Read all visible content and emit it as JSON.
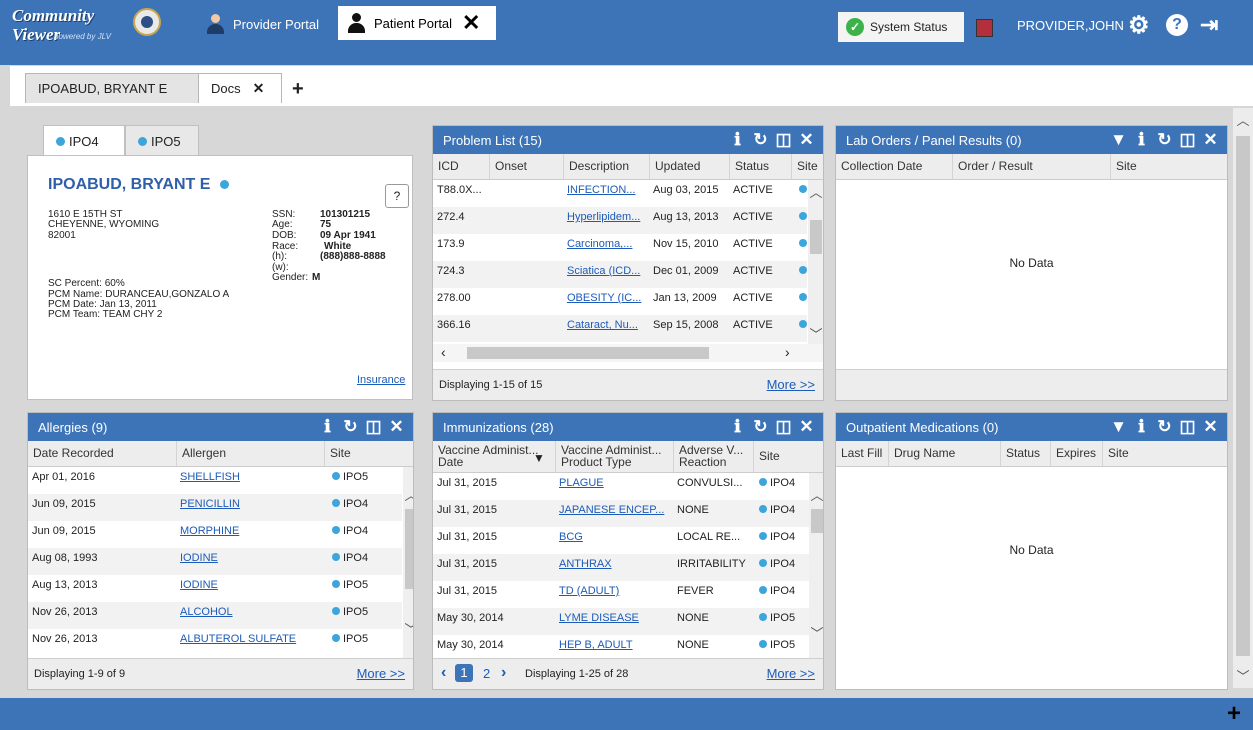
{
  "app": {
    "logo_line1": "Community",
    "logo_line2": "Viewer",
    "logo_tag": "powered by JLV"
  },
  "top_tabs": [
    {
      "label": "Provider Portal",
      "active": false
    },
    {
      "label": "Patient Portal",
      "active": true
    }
  ],
  "system_status": "System Status",
  "user_name": "PROVIDER,JOHN",
  "colors": {
    "header_blue": "#3d74b8",
    "link_blue": "#1c5bb8",
    "status_green": "#3bb34a",
    "site_dot": "#3ca5dc"
  },
  "patient_tabs": [
    {
      "label": "IPOABUD, BRYANT E",
      "active": true
    },
    {
      "label": "Docs",
      "active": false
    }
  ],
  "demographics": {
    "site_tabs": [
      "IPO4",
      "IPO5"
    ],
    "patient_name": "IPOABUD, BRYANT E",
    "help_button": "?",
    "address1": "1610 E 15TH ST",
    "address2": "CHEYENNE, WYOMING",
    "address3": "82001",
    "ssn_label": "SSN:",
    "ssn": "101301215",
    "age_label": "Age:",
    "age": "75",
    "dob_label": "DOB:",
    "dob": "09 Apr 1941",
    "race_label": "Race:",
    "race": "White",
    "home_phone_label": "(h):",
    "home_phone": "(888)888-8888",
    "work_phone_label": "(w):",
    "gender_label": "Gender:",
    "gender": "M",
    "sc_percent": "SC Percent: 60%",
    "pcm_name": "PCM Name: DURANCEAU,GONZALO A",
    "pcm_date": "PCM Date:  Jan 13, 2011",
    "pcm_team": "PCM Team:  TEAM CHY 2",
    "insurance_link": "Insurance"
  },
  "problem_list": {
    "title": "Problem List (15)",
    "columns": [
      "ICD",
      "Onset",
      "Description",
      "Updated",
      "Status",
      "Site"
    ],
    "rows": [
      {
        "icd": "T88.0X...",
        "onset": "",
        "description": "INFECTION...",
        "updated": "Aug 03, 2015",
        "status": "ACTIVE"
      },
      {
        "icd": "272.4",
        "onset": "",
        "description": "Hyperlipidem...",
        "updated": "Aug 13, 2013",
        "status": "ACTIVE"
      },
      {
        "icd": "173.9",
        "onset": "",
        "description": "Carcinoma,...",
        "updated": "Nov 15, 2010",
        "status": "ACTIVE"
      },
      {
        "icd": "724.3",
        "onset": "",
        "description": "Sciatica (ICD...",
        "updated": "Dec 01, 2009",
        "status": "ACTIVE"
      },
      {
        "icd": "278.00",
        "onset": "",
        "description": "OBESITY (IC...",
        "updated": "Jan 13, 2009",
        "status": "ACTIVE"
      },
      {
        "icd": "366.16",
        "onset": "",
        "description": "Cataract, Nu...",
        "updated": "Sep 15, 2008",
        "status": "ACTIVE"
      }
    ],
    "footer": "Displaying 1-15 of 15",
    "more": "More >>"
  },
  "lab_orders": {
    "title": "Lab Orders / Panel Results (0)",
    "columns": [
      "Collection Date",
      "Order / Result",
      "Site"
    ],
    "empty": "No Data"
  },
  "allergies": {
    "title": "Allergies (9)",
    "columns": [
      "Date Recorded",
      "Allergen",
      "Site"
    ],
    "rows": [
      {
        "date": "Apr 01, 2016",
        "allergen": "SHELLFISH",
        "site": "IPO5"
      },
      {
        "date": "Jun 09, 2015",
        "allergen": "PENICILLIN",
        "site": "IPO4"
      },
      {
        "date": "Jun 09, 2015",
        "allergen": "MORPHINE",
        "site": "IPO4"
      },
      {
        "date": "Aug 08, 1993",
        "allergen": "IODINE",
        "site": "IPO4"
      },
      {
        "date": "Aug 13, 2013",
        "allergen": "IODINE",
        "site": "IPO5"
      },
      {
        "date": "Nov 26, 2013",
        "allergen": "ALCOHOL",
        "site": "IPO5"
      },
      {
        "date": "Nov 26, 2013",
        "allergen": "ALBUTEROL SULFATE",
        "site": "IPO5"
      }
    ],
    "footer": "Displaying 1-9 of 9",
    "more": "More >>"
  },
  "immunizations": {
    "title": "Immunizations (28)",
    "columns": [
      "Vaccine Administ... Date",
      "Vaccine Administ... Product Type",
      "Adverse V... Reaction",
      "Site"
    ],
    "rows": [
      {
        "date": "Jul 31, 2015",
        "product": "PLAGUE",
        "reaction": "CONVULSI...",
        "site": "IPO4"
      },
      {
        "date": "Jul 31, 2015",
        "product": "JAPANESE ENCEP...",
        "reaction": "NONE",
        "site": "IPO4"
      },
      {
        "date": "Jul 31, 2015",
        "product": "BCG",
        "reaction": "LOCAL RE...",
        "site": "IPO4"
      },
      {
        "date": "Jul 31, 2015",
        "product": "ANTHRAX",
        "reaction": "IRRITABILITY",
        "site": "IPO4"
      },
      {
        "date": "Jul 31, 2015",
        "product": "TD (ADULT)",
        "reaction": "FEVER",
        "site": "IPO4"
      },
      {
        "date": "May 30, 2014",
        "product": "LYME DISEASE",
        "reaction": "NONE",
        "site": "IPO5"
      },
      {
        "date": "May 30, 2014",
        "product": "HEP B, ADULT",
        "reaction": "NONE",
        "site": "IPO5"
      }
    ],
    "pages": [
      "1",
      "2"
    ],
    "footer": "Displaying 1-25 of 28",
    "more": "More >>"
  },
  "outpatient_meds": {
    "title": "Outpatient Medications (0)",
    "columns": [
      "Last Fill",
      "Drug Name",
      "Status",
      "Expires",
      "Site"
    ],
    "empty": "No Data"
  }
}
